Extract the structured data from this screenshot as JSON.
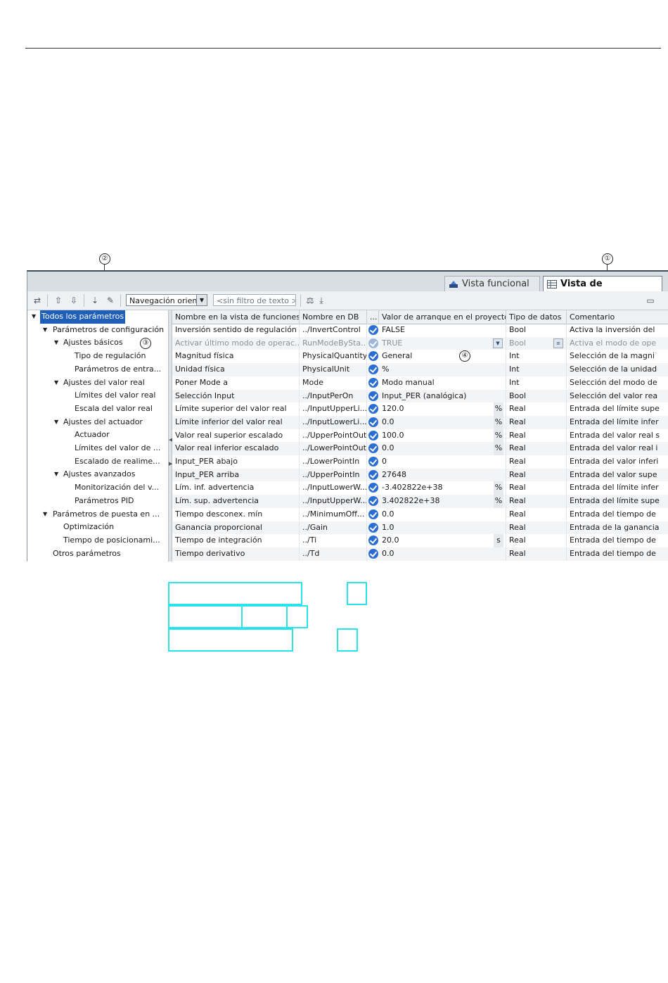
{
  "callouts": [
    "②",
    "①",
    "③",
    "④"
  ],
  "tabs": {
    "functional": "Vista funcional",
    "parameters": "Vista de parámetros"
  },
  "toolbar": {
    "nav_select_value": "Navegación orient",
    "filter_placeholder": "<sin filtro de texto >"
  },
  "tree": [
    {
      "label": "Todos los parámetros",
      "toggle": "▼"
    },
    {
      "label": "Parámetros de configuración",
      "toggle": "▼"
    },
    {
      "label": "Ajustes básicos",
      "toggle": "▼"
    },
    {
      "label": "Tipo de regulación",
      "toggle": ""
    },
    {
      "label": "Parámetros de entra...",
      "toggle": ""
    },
    {
      "label": "Ajustes del valor real",
      "toggle": "▼"
    },
    {
      "label": "Límites del valor real",
      "toggle": ""
    },
    {
      "label": "Escala del valor real",
      "toggle": ""
    },
    {
      "label": "Ajustes del actuador",
      "toggle": "▼"
    },
    {
      "label": "Actuador",
      "toggle": ""
    },
    {
      "label": "Límites del valor de ...",
      "toggle": ""
    },
    {
      "label": "Escalado de realime...",
      "toggle": ""
    },
    {
      "label": "Ajustes avanzados",
      "toggle": "▼"
    },
    {
      "label": "Monitorización del v...",
      "toggle": ""
    },
    {
      "label": "Parámetros PID",
      "toggle": ""
    },
    {
      "label": "Parámetros de puesta en ...",
      "toggle": "▼"
    },
    {
      "label": "Optimización",
      "toggle": ""
    },
    {
      "label": "Tiempo de posicionami...",
      "toggle": ""
    },
    {
      "label": "Otros parámetros",
      "toggle": ""
    }
  ],
  "columns": [
    "Nombre en la vista de funciones",
    "Nombre en DB",
    "...",
    "Valor de arranque en el proyecto",
    "Tipo de datos",
    "Comentario"
  ],
  "rows": [
    {
      "name": "Inversión sentido de regulación",
      "db": "../InvertControl",
      "value": "FALSE",
      "unit": "",
      "type": "Bool",
      "comment": "Activa la inversión del"
    },
    {
      "name": "Activar último modo de operac...",
      "db": "RunModeBySta...",
      "value": "TRUE",
      "unit": "",
      "type": "Bool",
      "comment": "Activa el modo de ope"
    },
    {
      "name": "Magnitud física",
      "db": "PhysicalQuantity",
      "value": "General",
      "unit": "",
      "type": "Int",
      "comment": "Selección de la magni"
    },
    {
      "name": "Unidad física",
      "db": "PhysicalUnit",
      "value": "%",
      "unit": "",
      "type": "Int",
      "comment": "Selección de la unidad"
    },
    {
      "name": "Poner Mode a",
      "db": "Mode",
      "value": "Modo manual",
      "unit": "",
      "type": "Int",
      "comment": "Selección del modo de"
    },
    {
      "name": "Selección Input",
      "db": "../InputPerOn",
      "value": "Input_PER (analógica)",
      "unit": "",
      "type": "Bool",
      "comment": "Selección del valor rea"
    },
    {
      "name": "Límite superior del valor real",
      "db": "../InputUpperLi...",
      "value": "120.0",
      "unit": "%",
      "type": "Real",
      "comment": "Entrada del límite supe"
    },
    {
      "name": "Límite inferior del valor real",
      "db": "../InputLowerLi...",
      "value": "0.0",
      "unit": "%",
      "type": "Real",
      "comment": "Entrada del límite infer"
    },
    {
      "name": "Valor real superior escalado",
      "db": "../UpperPointOut",
      "value": "100.0",
      "unit": "%",
      "type": "Real",
      "comment": "Entrada del valor real s"
    },
    {
      "name": "Valor real inferior escalado",
      "db": "../LowerPointOut",
      "value": "0.0",
      "unit": "%",
      "type": "Real",
      "comment": "Entrada del valor real i"
    },
    {
      "name": "Input_PER abajo",
      "db": "../LowerPointIn",
      "value": "0",
      "unit": "",
      "type": "Real",
      "comment": "Entrada del valor inferi"
    },
    {
      "name": "Input_PER arriba",
      "db": "../UpperPointIn",
      "value": "27648",
      "unit": "",
      "type": "Real",
      "comment": "Entrada del valor supe"
    },
    {
      "name": "Lím. inf. advertencia",
      "db": "../InputLowerW...",
      "value": "-3.402822e+38",
      "unit": "%",
      "type": "Real",
      "comment": "Entrada del límite infer"
    },
    {
      "name": "Lím. sup. advertencia",
      "db": "../InputUpperW...",
      "value": "3.402822e+38",
      "unit": "%",
      "type": "Real",
      "comment": "Entrada del límite supe"
    },
    {
      "name": "Tiempo desconex. mín",
      "db": "../MinimumOff...",
      "value": "0.0",
      "unit": "",
      "type": "Real",
      "comment": "Entrada del tiempo de"
    },
    {
      "name": "Ganancia proporcional",
      "db": "../Gain",
      "value": "1.0",
      "unit": "",
      "type": "Real",
      "comment": "Entrada de la ganancia"
    },
    {
      "name": "Tiempo de integración",
      "db": "../Ti",
      "value": "20.0",
      "unit": "s",
      "type": "Real",
      "comment": "Entrada del tiempo de"
    },
    {
      "name": "Tiempo derivativo",
      "db": "../Td",
      "value": "0.0",
      "unit": "",
      "type": "Real",
      "comment": "Entrada del tiempo de"
    }
  ]
}
